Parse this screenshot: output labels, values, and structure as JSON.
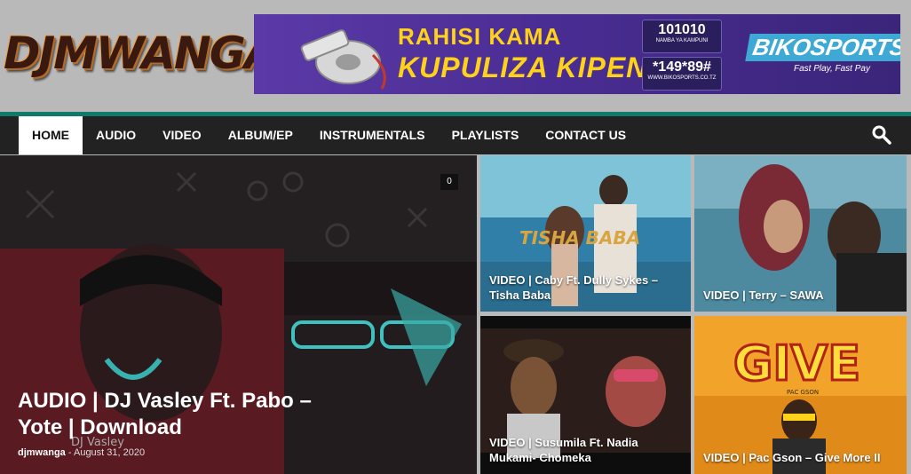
{
  "logo": {
    "text": "DJMWANGA"
  },
  "banner": {
    "line1": "RAHISI KAMA",
    "line2": "KUPULIZA KIPENGA",
    "company_number": "101010",
    "company_label": "NAMBA YA KAMPUNI",
    "ussd": "*149*89#",
    "website": "WWW.BIKOSPORTS.CO.TZ",
    "brand": "BIKOSPORTS",
    "tagline": "Fast Play, Fast Pay"
  },
  "nav": {
    "items": [
      "HOME",
      "AUDIO",
      "VIDEO",
      "ALBUM/EP",
      "INSTRUMENTALS",
      "PLAYLISTS",
      "CONTACT US"
    ],
    "active_index": 0
  },
  "featured": {
    "title": "AUDIO | DJ Vasley Ft. Pabo – Yote | Download",
    "author": "djmwanga",
    "separator": "-",
    "date": "August 31, 2020",
    "comment_count": "0",
    "artwork_text": "DJ Vasley"
  },
  "tiles": [
    {
      "title": "VIDEO | Caby Ft. Dully Sykes – Tisha Baba",
      "overlay": "TISHA BABA"
    },
    {
      "title": "VIDEO | Terry – SAWA"
    },
    {
      "title": "VIDEO | Susumila Ft. Nadia Mukami- Chomeka"
    },
    {
      "title": "VIDEO | Pac Gson – Give More II",
      "overlay": "GIVE",
      "sub": "PAC GSON"
    }
  ],
  "colors": {
    "accent": "#0f7a6a",
    "nav_bg": "#222222",
    "banner_text": "#ffd21a"
  }
}
